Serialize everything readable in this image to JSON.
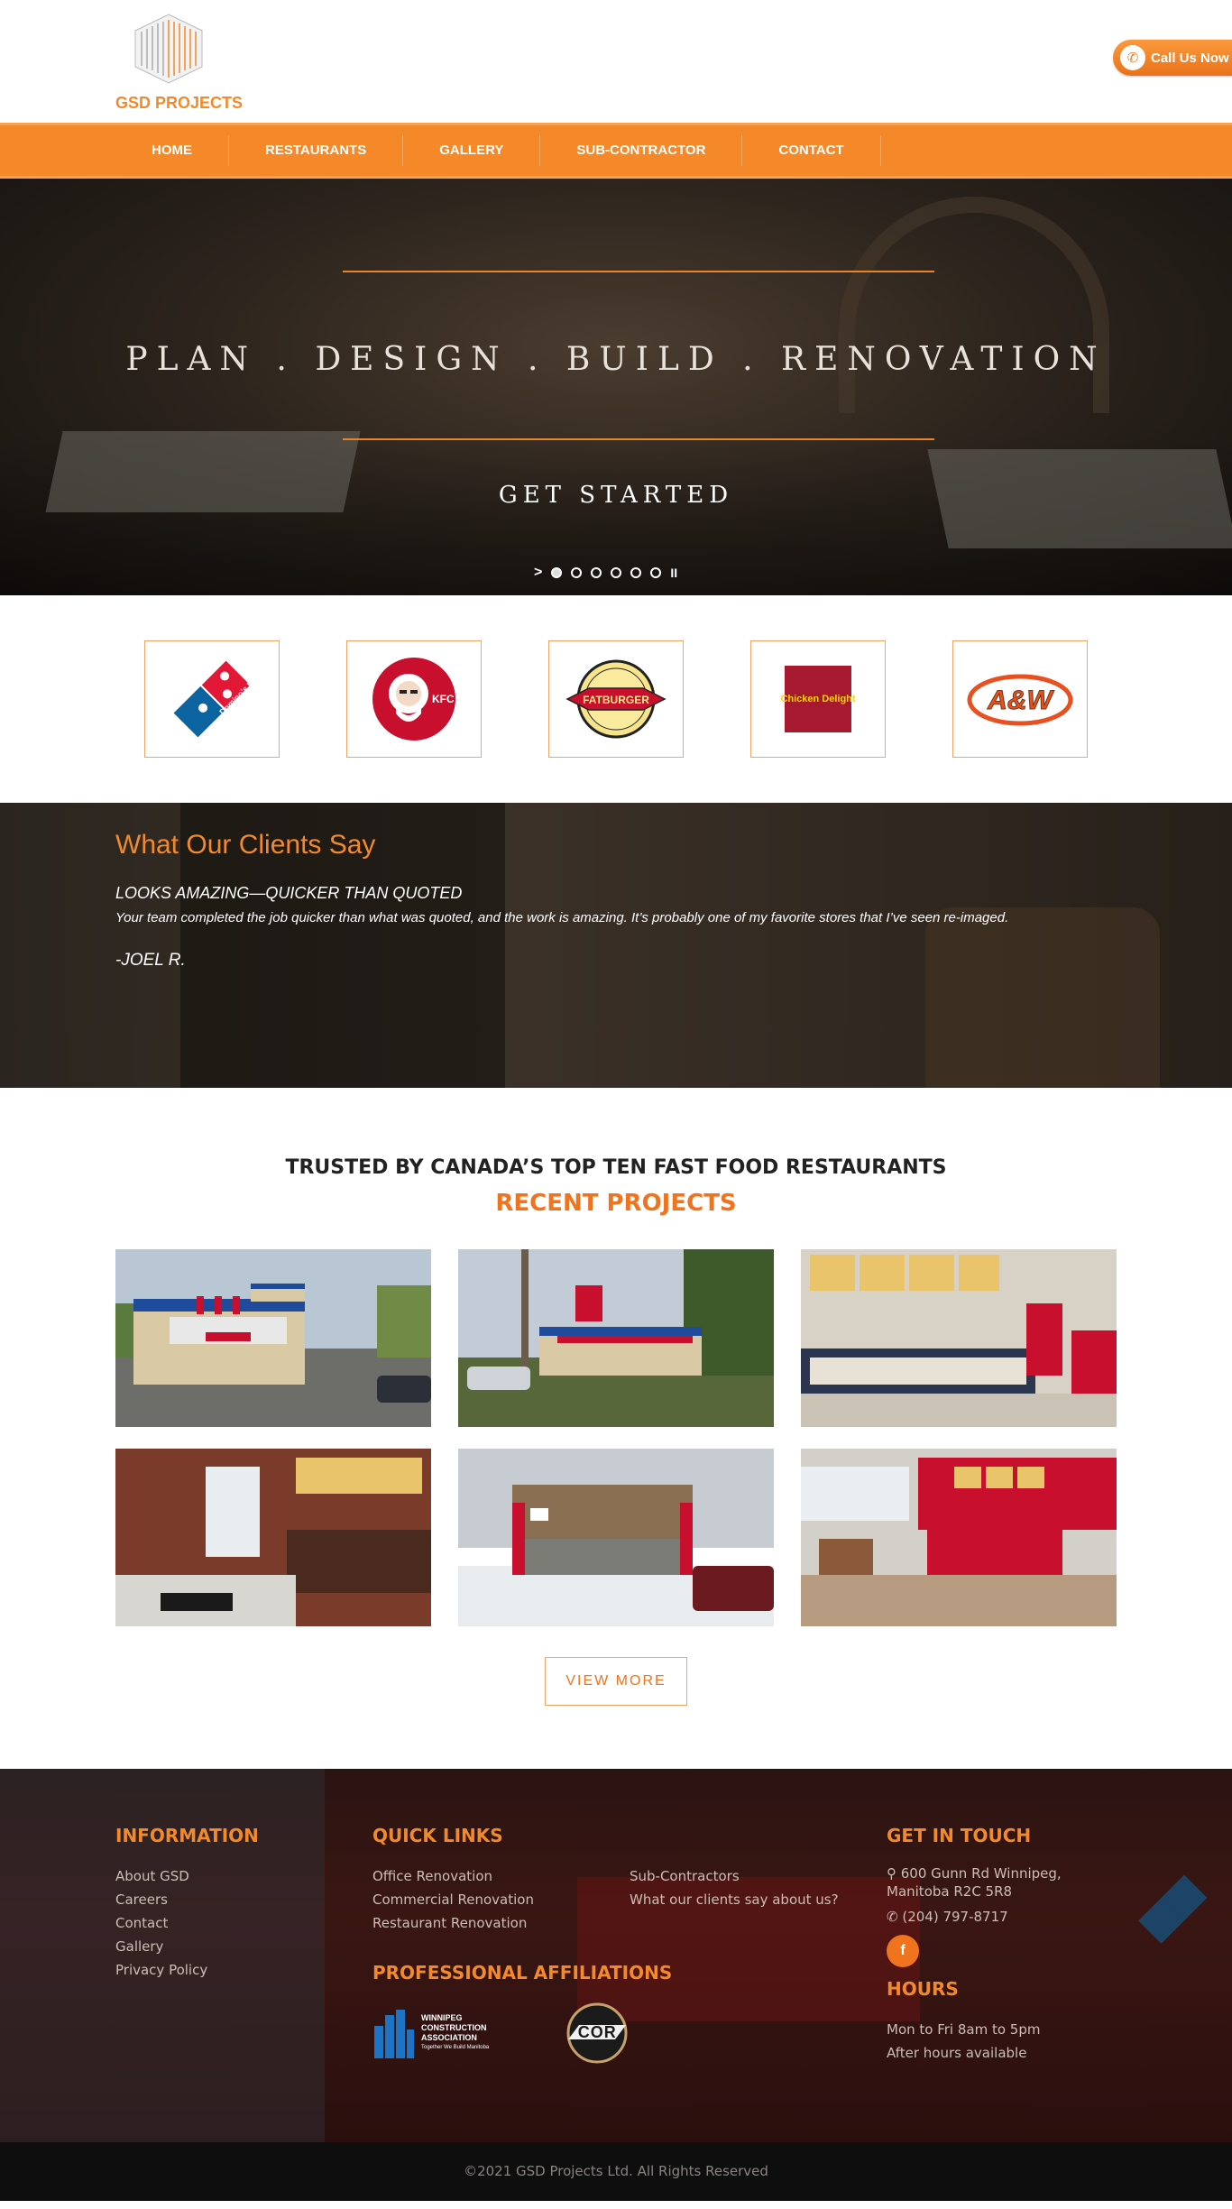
{
  "brand": {
    "logo_text": "GSD PROJECTS",
    "accent": "#f5892a"
  },
  "header": {
    "call_label": "Call Us Now"
  },
  "nav": {
    "items": [
      {
        "label": "HOME"
      },
      {
        "label": "RESTAURANTS"
      },
      {
        "label": "GALLERY"
      },
      {
        "label": "SUB-CONTRACTOR"
      },
      {
        "label": "CONTACT"
      }
    ]
  },
  "hero": {
    "title": "PLAN . DESIGN . BUILD . RENOVATION",
    "cta": "GET STARTED",
    "slide_count": 6,
    "active_slide": 1
  },
  "clients": {
    "logos": [
      {
        "name": "Domino's Pizza",
        "text": "Domino's Pizza"
      },
      {
        "name": "KFC",
        "text": "KFC"
      },
      {
        "name": "Fatburger",
        "text": "FATBURGER"
      },
      {
        "name": "Chicken Delight",
        "text": "Chicken Delight"
      },
      {
        "name": "A&W",
        "text": "A&W"
      }
    ]
  },
  "testimonial": {
    "heading": "What Our Clients Say",
    "title": "LOOKS AMAZING—QUICKER THAN QUOTED",
    "body": "Your team completed the job quicker than what was quoted, and the work is amazing. It’s probably one of my favorite stores that I’ve seen re-imaged.",
    "author": "-JOEL R."
  },
  "projects": {
    "tagline": "TRUSTED BY CANADA’S TOP TEN FAST FOOD RESTAURANTS",
    "title": "RECENT PROJECTS",
    "view_more": "VIEW MORE"
  },
  "footer": {
    "information": {
      "heading": "INFORMATION",
      "links": [
        "About GSD",
        "Careers",
        "Contact",
        "Gallery",
        "Privacy Policy"
      ]
    },
    "quick_links": {
      "heading": "QUICK LINKS",
      "links_col1": [
        "Office Renovation",
        "Commercial Renovation",
        "Restaurant Renovation"
      ],
      "links_col2": [
        "Sub-Contractors",
        "What our clients say about us?"
      ]
    },
    "affiliations": {
      "heading": "PROFESSIONAL AFFILIATIONS",
      "wca_line1": "WINNIPEG",
      "wca_line2": "CONSTRUCTION",
      "wca_line3": "ASSOCIATION",
      "wca_tagline": "Together We Build Manitoba",
      "cor_text": "COR"
    },
    "contact": {
      "heading": "GET IN TOUCH",
      "address": "600 Gunn Rd Winnipeg, Manitoba R2C 5R8",
      "phone": "(204) 797-8717",
      "facebook": "f"
    },
    "hours": {
      "heading": "HOURS",
      "line1": "Mon to Fri 8am to 5pm",
      "line2": "After hours available"
    },
    "copyright": "©2021 GSD Projects Ltd. All Rights Reserved"
  }
}
